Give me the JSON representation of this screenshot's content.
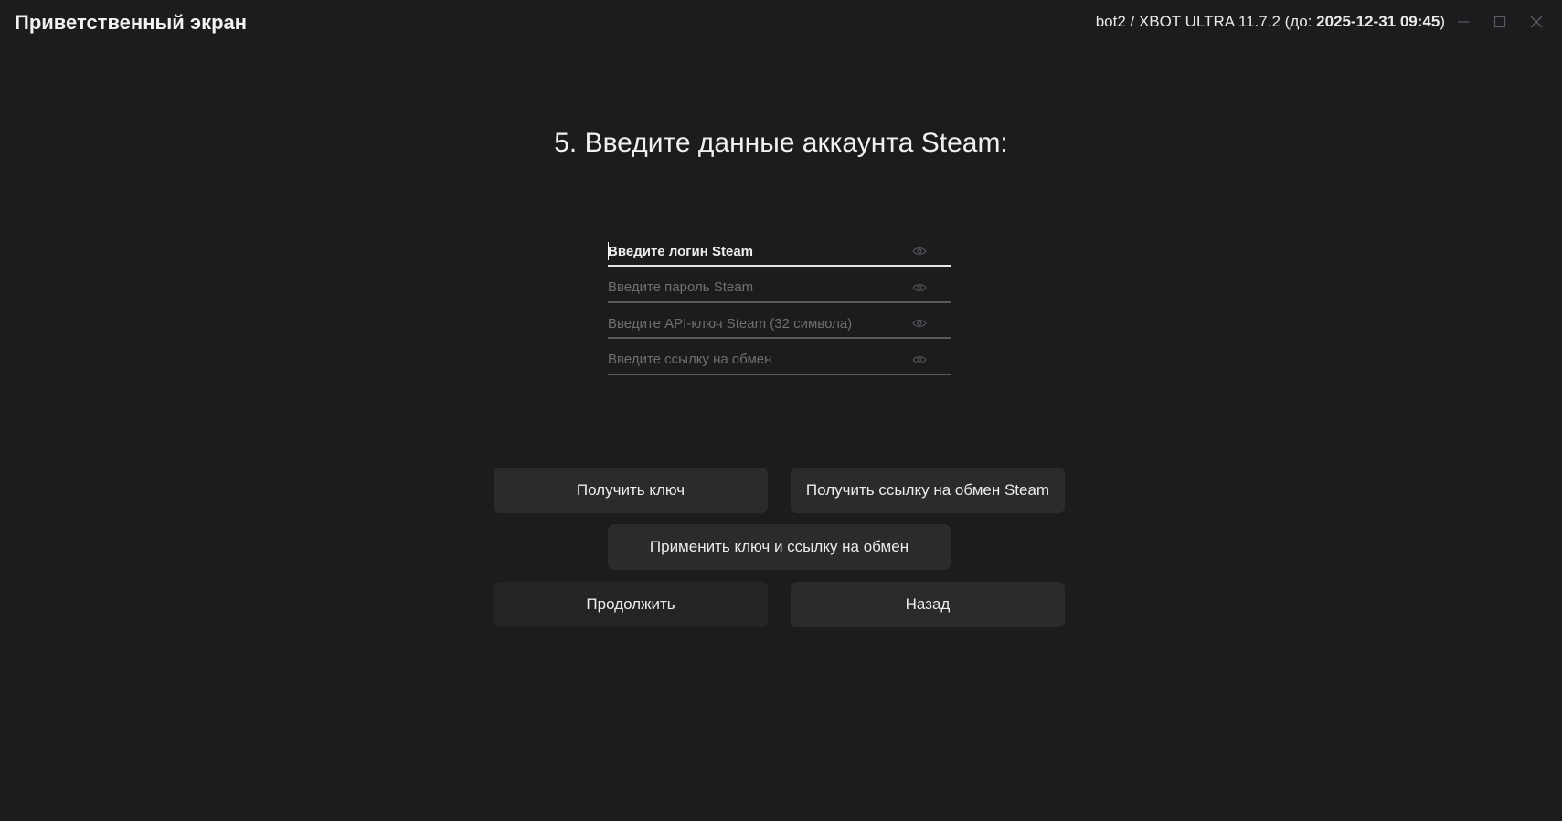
{
  "window": {
    "title": "Приветственный экран",
    "app_prefix": "bot2 / XBOT ULTRA 11.7.2",
    "until_label": "(до:",
    "until_value": "2025-12-31 09:45",
    "until_close": ")"
  },
  "step": {
    "title": "5. Введите данные аккаунта Steam:"
  },
  "fields": [
    {
      "placeholder": "Введите логин Steam",
      "value": "",
      "active": true
    },
    {
      "placeholder": "Введите пароль Steam",
      "value": "",
      "active": false
    },
    {
      "placeholder": "Введите API-ключ Steam (32 символа)",
      "value": "",
      "active": false
    },
    {
      "placeholder": "Введите ссылку на обмен",
      "value": "",
      "active": false
    }
  ],
  "buttons": {
    "get_key": "Получить ключ",
    "get_trade_link": "Получить ссылку на обмен Steam",
    "apply": "Применить ключ и ссылку на обмен",
    "continue": "Продолжить",
    "back": "Назад"
  },
  "icons": {
    "minimize": "minimize-icon",
    "maximize": "maximize-icon",
    "close": "close-icon",
    "eye": "eye-icon"
  },
  "colors": {
    "background": "#1c1c1e",
    "button": "#2b2b2d",
    "button_dim": "#242426",
    "underline": "#5a5a5c",
    "underline_active": "#e6e6e6"
  }
}
